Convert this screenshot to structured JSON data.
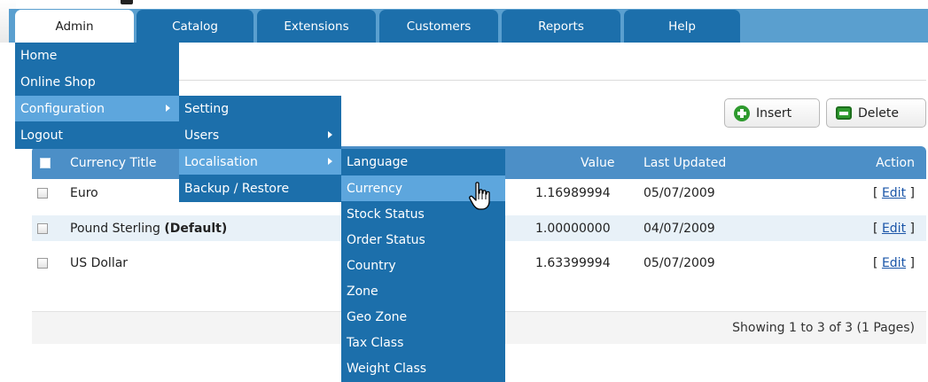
{
  "tabs": [
    {
      "label": "Admin",
      "active": true
    },
    {
      "label": "Catalog",
      "active": false
    },
    {
      "label": "Extensions",
      "active": false
    },
    {
      "label": "Customers",
      "active": false
    },
    {
      "label": "Reports",
      "active": false
    },
    {
      "label": "Help",
      "active": false
    }
  ],
  "toolbar": {
    "insert_label": "Insert",
    "delete_label": "Delete"
  },
  "table": {
    "headers": {
      "title": "Currency Title",
      "value": "Value",
      "updated": "Last Updated",
      "action": "Action"
    },
    "rows": [
      {
        "title": "Euro",
        "default_tag": "",
        "value": "1.16989994",
        "updated": "05/07/2009",
        "edit": "Edit"
      },
      {
        "title": "Pound Sterling",
        "default_tag": "(Default)",
        "value": "1.00000000",
        "updated": "04/07/2009",
        "edit": "Edit"
      },
      {
        "title": "US Dollar",
        "default_tag": "",
        "value": "1.63399994",
        "updated": "05/07/2009",
        "edit": "Edit"
      }
    ],
    "pagination": "Showing 1 to 3 of 3 (1 Pages)"
  },
  "admin_menu": [
    "Home",
    "Online Shop",
    "Configuration",
    "Logout"
  ],
  "config_menu": [
    "Setting",
    "Users",
    "Localisation",
    "Backup / Restore"
  ],
  "localisation_menu": [
    "Language",
    "Currency",
    "Stock Status",
    "Order Status",
    "Country",
    "Zone",
    "Geo Zone",
    "Tax Class",
    "Weight Class"
  ],
  "colors": {
    "nav_band": "#5a9fcf",
    "tab": "#1c6fab",
    "menu": "#1c6fab",
    "menu_highlight": "#5da6dd",
    "table_header": "#4c8fc7",
    "button_icon": "#2e9a2e"
  }
}
